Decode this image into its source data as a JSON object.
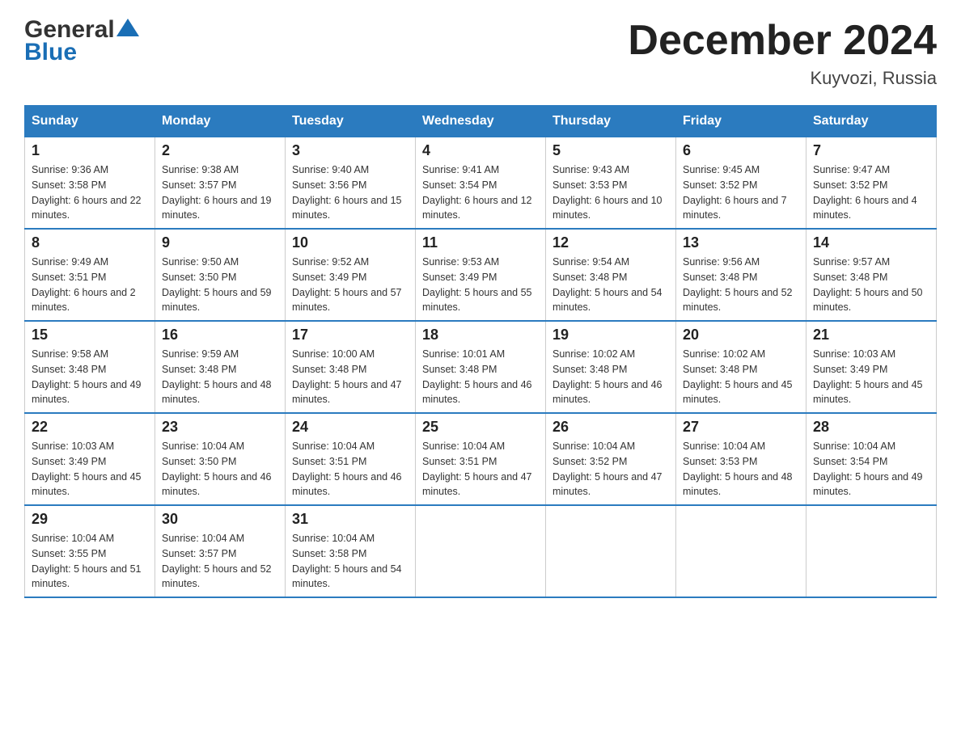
{
  "header": {
    "logo_text_general": "General",
    "logo_text_blue": "Blue",
    "month_title": "December 2024",
    "location": "Kuyvozi, Russia"
  },
  "days_of_week": [
    "Sunday",
    "Monday",
    "Tuesday",
    "Wednesday",
    "Thursday",
    "Friday",
    "Saturday"
  ],
  "weeks": [
    [
      {
        "num": "1",
        "sunrise": "9:36 AM",
        "sunset": "3:58 PM",
        "daylight": "6 hours and 22 minutes"
      },
      {
        "num": "2",
        "sunrise": "9:38 AM",
        "sunset": "3:57 PM",
        "daylight": "6 hours and 19 minutes"
      },
      {
        "num": "3",
        "sunrise": "9:40 AM",
        "sunset": "3:56 PM",
        "daylight": "6 hours and 15 minutes"
      },
      {
        "num": "4",
        "sunrise": "9:41 AM",
        "sunset": "3:54 PM",
        "daylight": "6 hours and 12 minutes"
      },
      {
        "num": "5",
        "sunrise": "9:43 AM",
        "sunset": "3:53 PM",
        "daylight": "6 hours and 10 minutes"
      },
      {
        "num": "6",
        "sunrise": "9:45 AM",
        "sunset": "3:52 PM",
        "daylight": "6 hours and 7 minutes"
      },
      {
        "num": "7",
        "sunrise": "9:47 AM",
        "sunset": "3:52 PM",
        "daylight": "6 hours and 4 minutes"
      }
    ],
    [
      {
        "num": "8",
        "sunrise": "9:49 AM",
        "sunset": "3:51 PM",
        "daylight": "6 hours and 2 minutes"
      },
      {
        "num": "9",
        "sunrise": "9:50 AM",
        "sunset": "3:50 PM",
        "daylight": "5 hours and 59 minutes"
      },
      {
        "num": "10",
        "sunrise": "9:52 AM",
        "sunset": "3:49 PM",
        "daylight": "5 hours and 57 minutes"
      },
      {
        "num": "11",
        "sunrise": "9:53 AM",
        "sunset": "3:49 PM",
        "daylight": "5 hours and 55 minutes"
      },
      {
        "num": "12",
        "sunrise": "9:54 AM",
        "sunset": "3:48 PM",
        "daylight": "5 hours and 54 minutes"
      },
      {
        "num": "13",
        "sunrise": "9:56 AM",
        "sunset": "3:48 PM",
        "daylight": "5 hours and 52 minutes"
      },
      {
        "num": "14",
        "sunrise": "9:57 AM",
        "sunset": "3:48 PM",
        "daylight": "5 hours and 50 minutes"
      }
    ],
    [
      {
        "num": "15",
        "sunrise": "9:58 AM",
        "sunset": "3:48 PM",
        "daylight": "5 hours and 49 minutes"
      },
      {
        "num": "16",
        "sunrise": "9:59 AM",
        "sunset": "3:48 PM",
        "daylight": "5 hours and 48 minutes"
      },
      {
        "num": "17",
        "sunrise": "10:00 AM",
        "sunset": "3:48 PM",
        "daylight": "5 hours and 47 minutes"
      },
      {
        "num": "18",
        "sunrise": "10:01 AM",
        "sunset": "3:48 PM",
        "daylight": "5 hours and 46 minutes"
      },
      {
        "num": "19",
        "sunrise": "10:02 AM",
        "sunset": "3:48 PM",
        "daylight": "5 hours and 46 minutes"
      },
      {
        "num": "20",
        "sunrise": "10:02 AM",
        "sunset": "3:48 PM",
        "daylight": "5 hours and 45 minutes"
      },
      {
        "num": "21",
        "sunrise": "10:03 AM",
        "sunset": "3:49 PM",
        "daylight": "5 hours and 45 minutes"
      }
    ],
    [
      {
        "num": "22",
        "sunrise": "10:03 AM",
        "sunset": "3:49 PM",
        "daylight": "5 hours and 45 minutes"
      },
      {
        "num": "23",
        "sunrise": "10:04 AM",
        "sunset": "3:50 PM",
        "daylight": "5 hours and 46 minutes"
      },
      {
        "num": "24",
        "sunrise": "10:04 AM",
        "sunset": "3:51 PM",
        "daylight": "5 hours and 46 minutes"
      },
      {
        "num": "25",
        "sunrise": "10:04 AM",
        "sunset": "3:51 PM",
        "daylight": "5 hours and 47 minutes"
      },
      {
        "num": "26",
        "sunrise": "10:04 AM",
        "sunset": "3:52 PM",
        "daylight": "5 hours and 47 minutes"
      },
      {
        "num": "27",
        "sunrise": "10:04 AM",
        "sunset": "3:53 PM",
        "daylight": "5 hours and 48 minutes"
      },
      {
        "num": "28",
        "sunrise": "10:04 AM",
        "sunset": "3:54 PM",
        "daylight": "5 hours and 49 minutes"
      }
    ],
    [
      {
        "num": "29",
        "sunrise": "10:04 AM",
        "sunset": "3:55 PM",
        "daylight": "5 hours and 51 minutes"
      },
      {
        "num": "30",
        "sunrise": "10:04 AM",
        "sunset": "3:57 PM",
        "daylight": "5 hours and 52 minutes"
      },
      {
        "num": "31",
        "sunrise": "10:04 AM",
        "sunset": "3:58 PM",
        "daylight": "5 hours and 54 minutes"
      },
      null,
      null,
      null,
      null
    ]
  ],
  "labels": {
    "sunrise": "Sunrise:",
    "sunset": "Sunset:",
    "daylight": "Daylight:"
  }
}
